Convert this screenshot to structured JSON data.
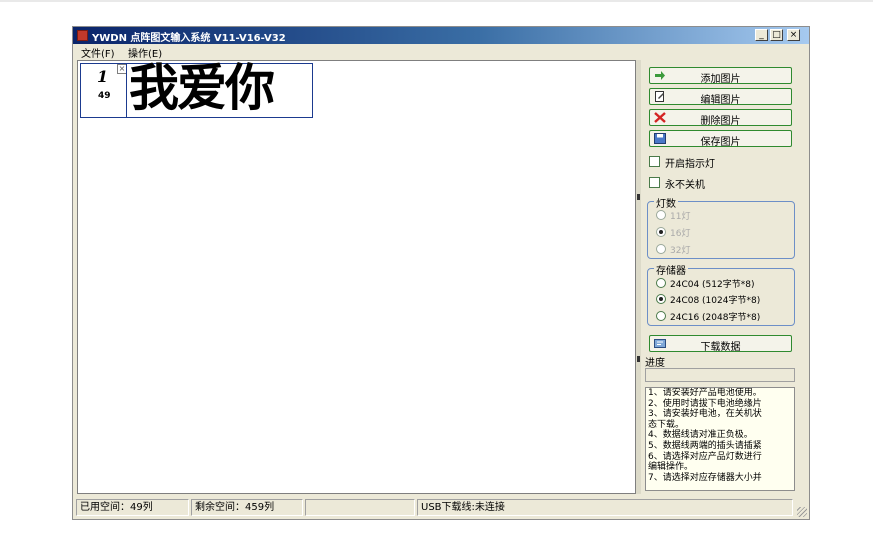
{
  "window": {
    "title": "YWDN 点阵图文输入系统 V11-V16-V32",
    "controls": {
      "minimize": "_",
      "maximize": "□",
      "close": "×"
    }
  },
  "menu": [
    {
      "label": "文件(F)"
    },
    {
      "label": "操作(E)"
    }
  ],
  "canvas": {
    "cell": {
      "index": "1",
      "columns": "49",
      "text": "我爱你"
    }
  },
  "panel": {
    "buttons": {
      "add": {
        "label": "添加图片",
        "icon": "arrow-right-icon"
      },
      "edit": {
        "label": "编辑图片",
        "icon": "edit-icon"
      },
      "delete": {
        "label": "删除图片",
        "icon": "delete-icon"
      },
      "save": {
        "label": "保存图片",
        "icon": "save-icon"
      }
    },
    "checkboxes": [
      {
        "label": "开启指示灯",
        "checked": false
      },
      {
        "label": "永不关机",
        "checked": false
      }
    ],
    "lamps": {
      "title": "灯数",
      "options": [
        {
          "label": "11灯",
          "selected": false,
          "disabled": true
        },
        {
          "label": "16灯",
          "selected": true,
          "disabled": true
        },
        {
          "label": "32灯",
          "selected": false,
          "disabled": true
        }
      ]
    },
    "storage": {
      "title": "存储器",
      "options": [
        {
          "label": "24C04 (512字节*8)",
          "selected": false
        },
        {
          "label": "24C08 (1024字节*8)",
          "selected": true
        },
        {
          "label": "24C16 (2048字节*8)",
          "selected": false
        }
      ]
    },
    "download": {
      "label": "下载数据",
      "icon": "download-icon"
    },
    "progress": {
      "label": "进度",
      "value": 0
    },
    "instructions": [
      "1、请安装好产品电池使用。",
      "2、使用时请拔下电池绝缘片",
      "3、请安装好电池，在关机状",
      "态下载。",
      "4、数据线请对准正负极。",
      "5、数据线两端的插头请插紧",
      "6、请选择对应产品灯数进行",
      "编辑操作。",
      "7、请选择对应存储器大小并"
    ]
  },
  "status": {
    "used": "已用空间：49列",
    "remaining": "剩余空间：459列",
    "usb": "USB下载线:未连接"
  },
  "colors": {
    "title_bar": "#0a246a",
    "button_border": "#2f8a2f",
    "cell_border": "#1b3a8f"
  }
}
